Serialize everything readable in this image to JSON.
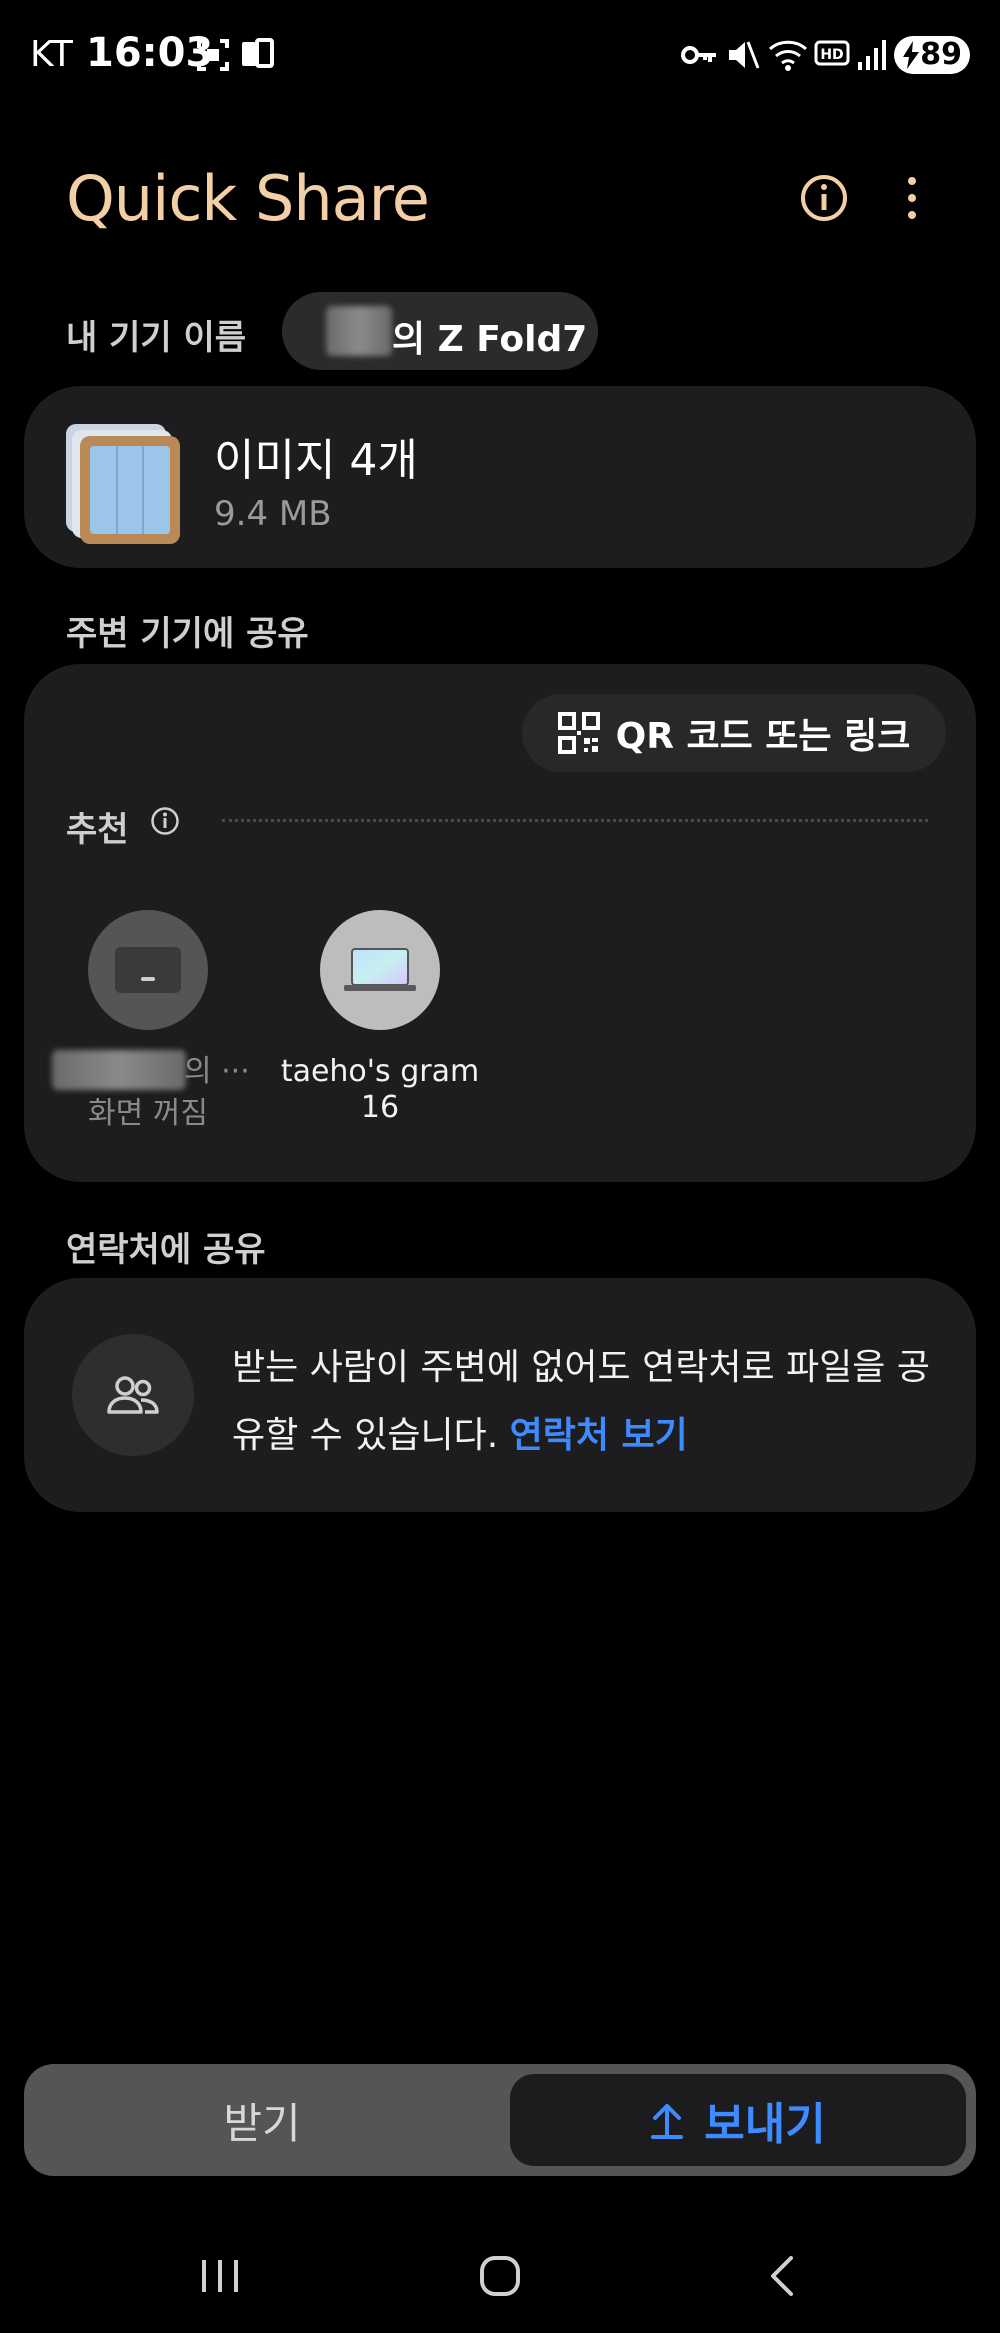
{
  "status_bar": {
    "carrier": "KT",
    "time": "16:03",
    "battery": "89"
  },
  "header": {
    "title": "Quick Share"
  },
  "device": {
    "label": "내 기기 이름",
    "name_suffix": "의 Z Fold7"
  },
  "file": {
    "title": "이미지 4개",
    "size": "9.4 MB"
  },
  "nearby": {
    "section_title": "주변 기기에 공유",
    "qr_button_label": "QR 코드 또는 링크",
    "recommended_label": "추천",
    "devices": [
      {
        "name_suffix": "의 ···",
        "status": "화면 꺼짐"
      },
      {
        "name_line1": "taeho's gram",
        "name_line2": "16"
      }
    ]
  },
  "contacts": {
    "section_title": "연락처에 공유",
    "description": "받는 사람이 주변에 없어도 연락처로 파일을 공유할 수 있습니다.",
    "link_label": "연락처 보기"
  },
  "bottom_tabs": {
    "receive_label": "받기",
    "send_label": "보내기"
  },
  "colors": {
    "title_accent": "#f2cfa5",
    "link_blue": "#3e8bff",
    "card_bg": "#1d1d1f"
  }
}
